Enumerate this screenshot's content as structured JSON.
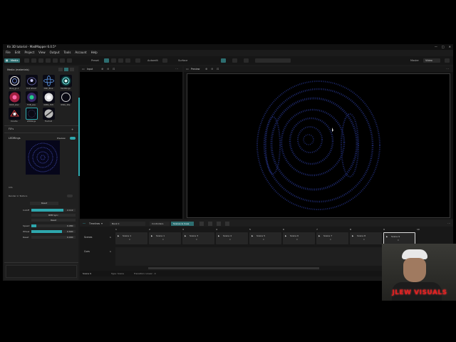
{
  "window": {
    "title": "Kn 3D tutorial - MadMapper 6.0.5*",
    "controls": [
      "—",
      "□",
      "✕"
    ]
  },
  "menu": [
    "File",
    "Edit",
    "Project",
    "View",
    "Output",
    "Tools",
    "Account",
    "Help"
  ],
  "toolbar": {
    "media": "Media",
    "preset": "Preset",
    "autoedit": "Autoedit",
    "surface": "Surface",
    "master": "Master",
    "video": "Video"
  },
  "media_panel": {
    "title": "Media (materials)",
    "thumbnails": [
      {
        "label": "Blue_go-1",
        "icon": "spiral-icon"
      },
      {
        "label": "Kn3 Ghost",
        "icon": "ghost-icon"
      },
      {
        "label": "DNC_Blue",
        "icon": "atom-icon"
      },
      {
        "label": "MultiRings",
        "icon": "rings-icon"
      },
      {
        "label": "ROW_sber",
        "icon": "burst-icon"
      },
      {
        "label": "FOB_size",
        "icon": "flower-icon"
      },
      {
        "label": "ORBS_5X8",
        "icon": "orb-icon"
      },
      {
        "label": "RING_4Rp",
        "icon": "ring-icon"
      },
      {
        "label": "Doodle",
        "icon": "doodle-icon"
      },
      {
        "label": "LEDRings",
        "icon": "ledrings-icon"
      },
      {
        "label": "Fractoid",
        "icon": "fractal-icon"
      }
    ],
    "fx_label": "FX's",
    "selected_name": "LEDRings",
    "preview_label": "Preview",
    "info_label": "Info",
    "render_label": "Render in Texture",
    "reset_button": "Reset",
    "params": [
      {
        "name": "Cutoff",
        "value": "2.112",
        "fill": 0.72
      },
      {
        "name": "BPM Sync",
        "value": "",
        "fill": 0
      },
      {
        "name": "Reset",
        "value": "",
        "fill": 0
      },
      {
        "name": "Speed",
        "value": "0.080",
        "fill": 0.12
      },
      {
        "name": "Wheel",
        "value": "0.690",
        "fill": 0.7
      },
      {
        "name": "Reset",
        "value": "0.000",
        "fill": 0
      }
    ]
  },
  "input_view": {
    "title": "Input"
  },
  "output_view": {
    "title": "Preview"
  },
  "timeline": {
    "title": "Timelines",
    "bank": "Bank 0",
    "tab_controls": "Controllers",
    "tab_scenes": "Scenes & Cues",
    "row1_label": "Scenes",
    "row2_label": "Cues",
    "row_index_1": "1",
    "row_index_2": "1",
    "columns": [
      "1",
      "2",
      "3",
      "4",
      "5",
      "6",
      "7",
      "8",
      "9",
      "10"
    ],
    "scenes": [
      {
        "name": "Scene 1",
        "sub": "0"
      },
      {
        "name": "Scene 1",
        "sub": "0"
      },
      {
        "name": "Scene 3",
        "sub": "0"
      },
      {
        "name": "Scene 4",
        "sub": "0"
      },
      {
        "name": "Scene 5",
        "sub": "0"
      },
      {
        "name": "Scene 6",
        "sub": "0"
      },
      {
        "name": "Scene 7",
        "sub": "0"
      },
      {
        "name": "Scene 8",
        "sub": "0"
      },
      {
        "name": "Scene 9",
        "sub": "0"
      }
    ],
    "status_left": "Scene 9",
    "status_type": "Type: Scene",
    "status_transition": "Transition: Linear · 0"
  },
  "webcam": {
    "overlay_text": "JLEW VISUALS"
  },
  "colors": {
    "accent": "#2ea7ad",
    "output_dots": "#1e2a6e"
  }
}
